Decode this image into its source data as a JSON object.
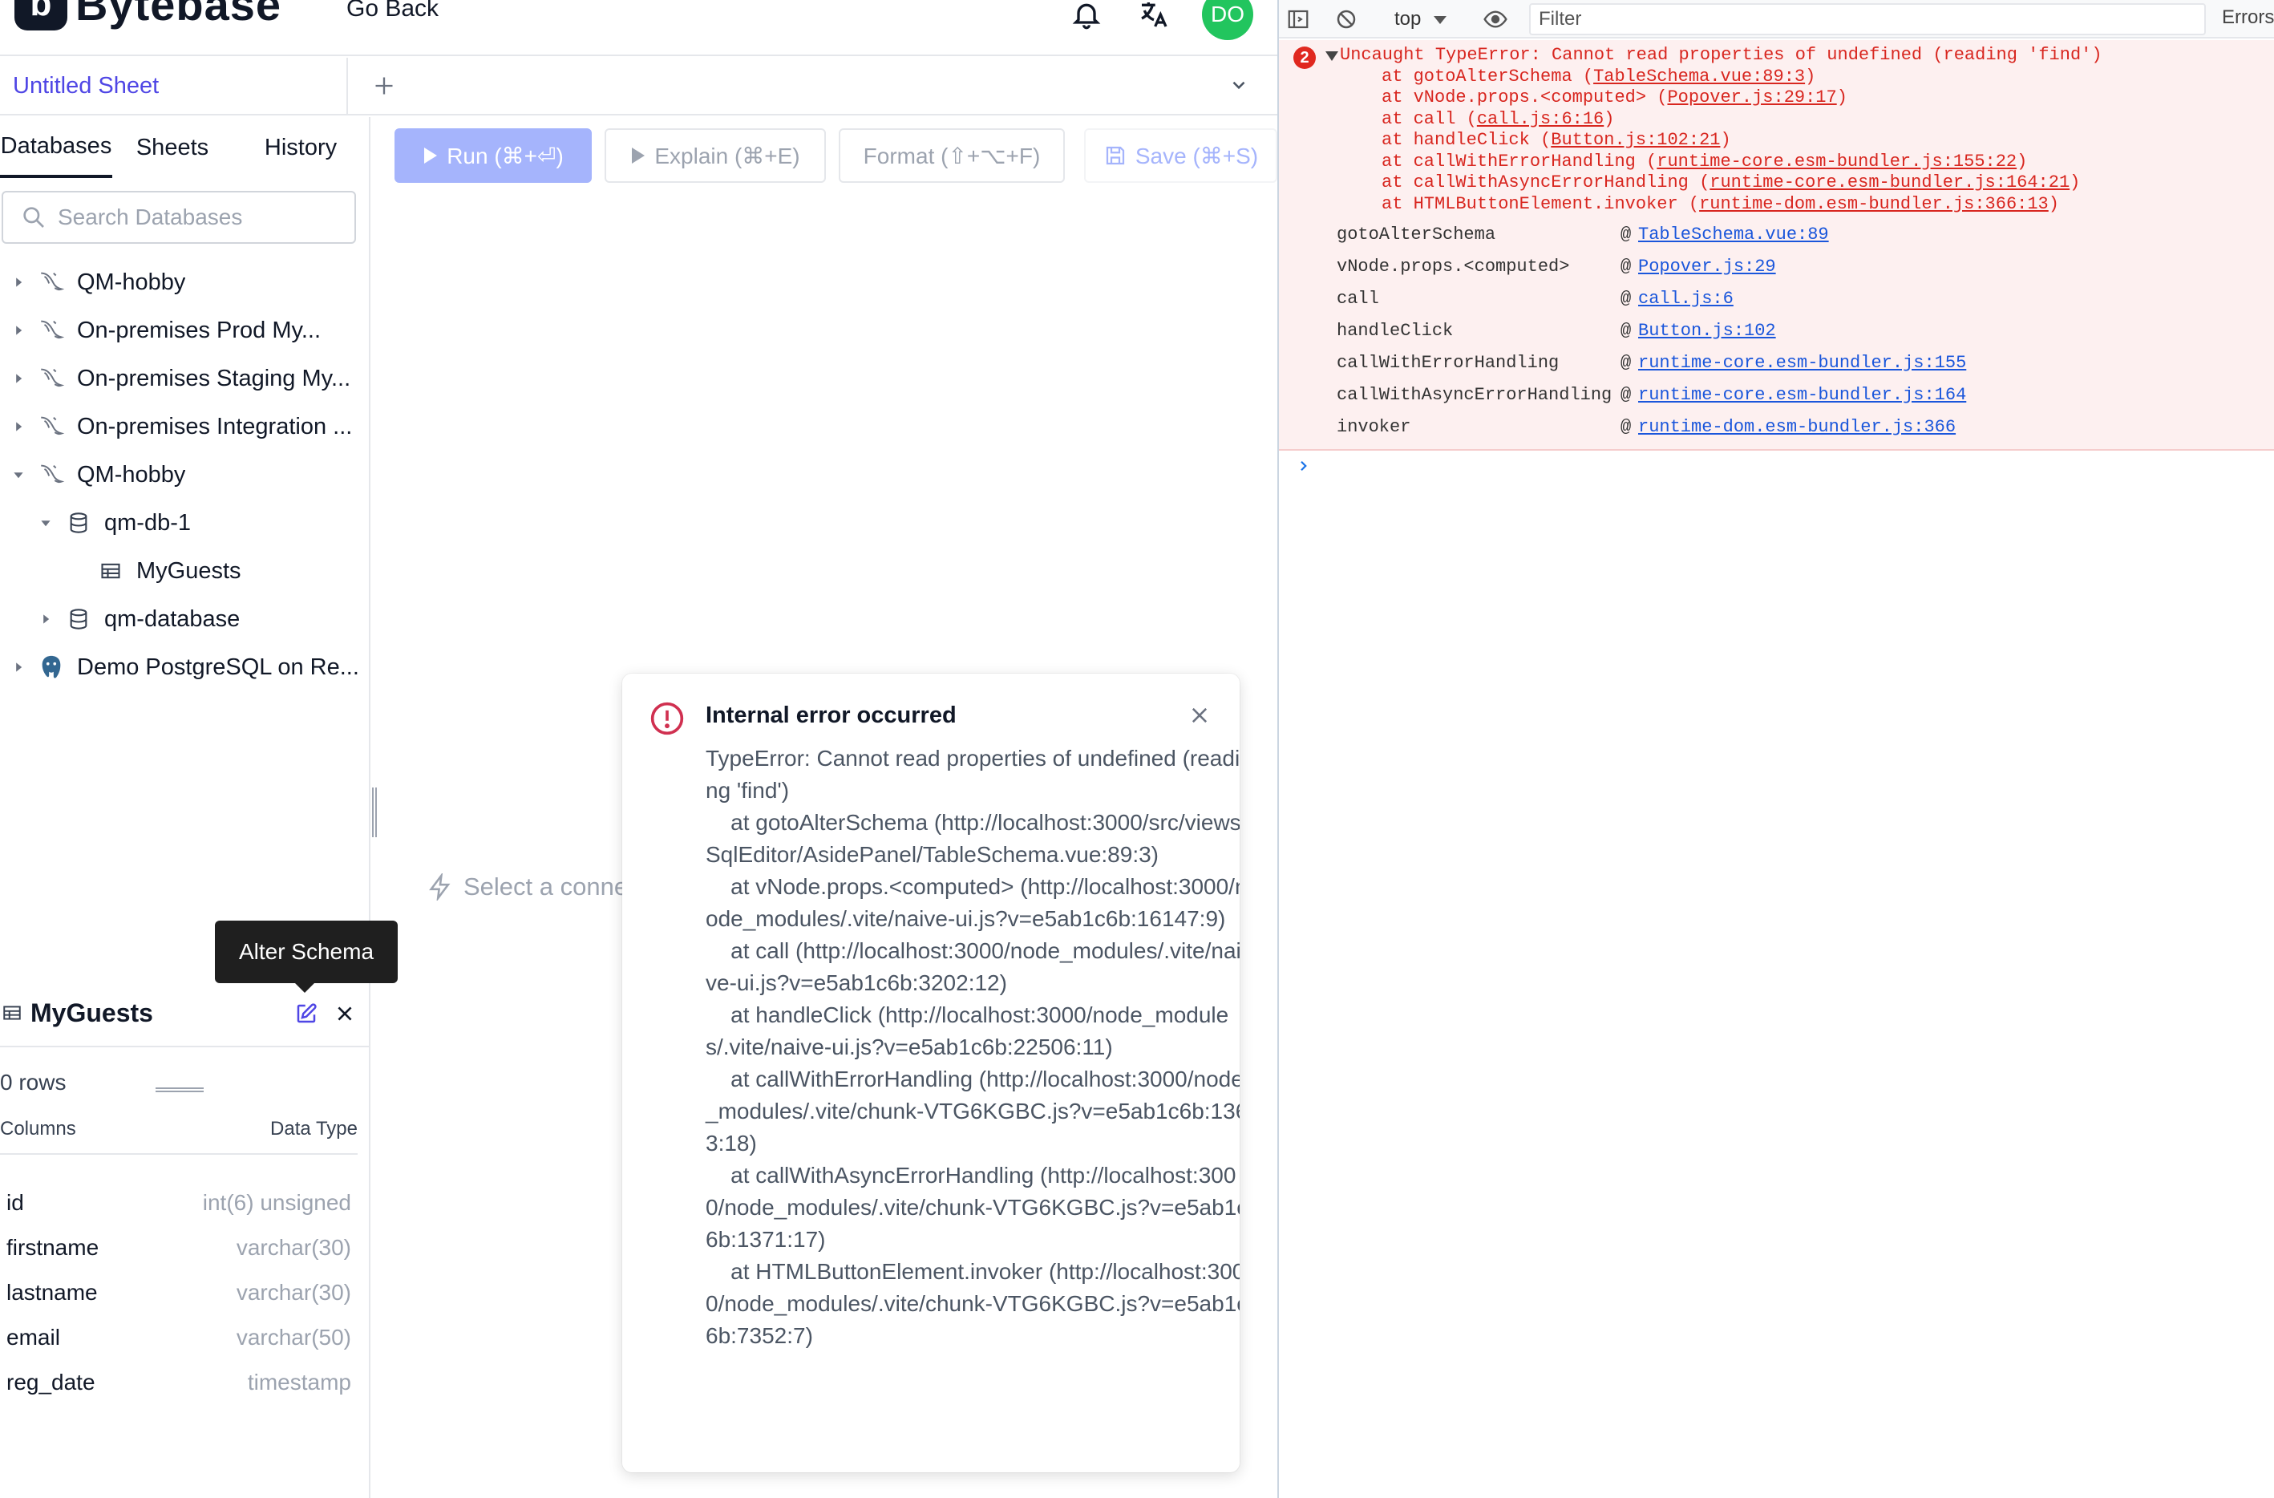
{
  "header": {
    "logo_mark": "b",
    "logo_text": "Bytebase",
    "go_back": "Go Back",
    "avatar_initials": "DO"
  },
  "sheet_tabs": {
    "active": "Untitled Sheet"
  },
  "sidebar": {
    "tabs": [
      "Databases",
      "Sheets",
      "History"
    ],
    "search_placeholder": "Search Databases",
    "tree": [
      {
        "label": "QM-hobby",
        "icon": "mysql-icon",
        "expanded": false,
        "level": 0
      },
      {
        "label": "On-premises Prod My...",
        "icon": "mysql-icon",
        "expanded": false,
        "level": 0
      },
      {
        "label": "On-premises Staging My...",
        "icon": "mysql-icon",
        "expanded": false,
        "level": 0
      },
      {
        "label": "On-premises Integration ...",
        "icon": "mysql-icon",
        "expanded": false,
        "level": 0
      },
      {
        "label": "QM-hobby",
        "icon": "mysql-icon",
        "expanded": true,
        "level": 0
      },
      {
        "label": "qm-db-1",
        "icon": "database-icon",
        "expanded": true,
        "level": 1
      },
      {
        "label": "MyGuests",
        "icon": "table-icon",
        "expanded": null,
        "level": 2
      },
      {
        "label": "qm-database",
        "icon": "database-icon",
        "expanded": false,
        "level": 1
      },
      {
        "label": "Demo PostgreSQL on Re...",
        "icon": "postgresql-icon",
        "expanded": false,
        "level": 0
      }
    ]
  },
  "table_panel": {
    "title": "MyGuests",
    "rows": "0 rows",
    "col_header": "Columns",
    "type_header": "Data Type",
    "columns": [
      {
        "name": "id",
        "type": "int(6) unsigned"
      },
      {
        "name": "firstname",
        "type": "varchar(30)"
      },
      {
        "name": "lastname",
        "type": "varchar(30)"
      },
      {
        "name": "email",
        "type": "varchar(50)"
      },
      {
        "name": "reg_date",
        "type": "timestamp"
      }
    ]
  },
  "tooltip": "Alter Schema",
  "toolbar": {
    "run": "Run (⌘+⏎)",
    "explain": "Explain (⌘+E)",
    "format": "Format (⇧+⌥+F)",
    "save": "Save (⌘+S)"
  },
  "editor": {
    "hint": "Select a connection"
  },
  "dialog": {
    "title": "Internal error occurred",
    "body": "TypeError: Cannot read properties of undefined (reading 'find')\n    at gotoAlterSchema (http://localhost:3000/src/views/SqlEditor/AsidePanel/TableSchema.vue:89:3)\n    at vNode.props.<computed> (http://localhost:3000/node_modules/.vite/naive-ui.js?v=e5ab1c6b:16147:9)\n    at call (http://localhost:3000/node_modules/.vite/naive-ui.js?v=e5ab1c6b:3202:12)\n    at handleClick (http://localhost:3000/node_modules/.vite/naive-ui.js?v=e5ab1c6b:22506:11)\n    at callWithErrorHandling (http://localhost:3000/node_modules/.vite/chunk-VTG6KGBC.js?v=e5ab1c6b:1363:18)\n    at callWithAsyncErrorHandling (http://localhost:3000/node_modules/.vite/chunk-VTG6KGBC.js?v=e5ab1c6b:1371:17)\n    at HTMLButtonElement.invoker (http://localhost:3000/node_modules/.vite/chunk-VTG6KGBC.js?v=e5ab1c6b:7352:7)"
  },
  "devtools": {
    "context": "top",
    "filter_placeholder": "Filter",
    "levels": "Errors",
    "error_count": "2",
    "error_message": "Uncaught TypeError: Cannot read properties of undefined (reading 'find')",
    "error_frames": [
      {
        "fn": "gotoAlterSchema",
        "loc": "TableSchema.vue:89:3"
      },
      {
        "fn": "vNode.props.<computed>",
        "loc": "Popover.js:29:17"
      },
      {
        "fn": "call",
        "loc": "call.js:6:16"
      },
      {
        "fn": "handleClick",
        "loc": "Button.js:102:21"
      },
      {
        "fn": "callWithErrorHandling",
        "loc": "runtime-core.esm-bundler.js:155:22"
      },
      {
        "fn": "callWithAsyncErrorHandling",
        "loc": "runtime-core.esm-bundler.js:164:21"
      },
      {
        "fn": "HTMLButtonElement.invoker",
        "loc": "runtime-dom.esm-bundler.js:366:13"
      }
    ],
    "stack": [
      {
        "fn": "gotoAlterSchema",
        "link": "TableSchema.vue:89"
      },
      {
        "fn": "vNode.props.<computed>",
        "link": "Popover.js:29"
      },
      {
        "fn": "call",
        "link": "call.js:6"
      },
      {
        "fn": "handleClick",
        "link": "Button.js:102"
      },
      {
        "fn": "callWithErrorHandling",
        "link": "runtime-core.esm-bundler.js:155"
      },
      {
        "fn": "callWithAsyncErrorHandling",
        "link": "runtime-core.esm-bundler.js:164"
      },
      {
        "fn": "invoker",
        "link": "runtime-dom.esm-bundler.js:366"
      }
    ],
    "prompt": "›"
  },
  "colors": {
    "accent": "#4f46e5",
    "run_button": "#a5b4fc",
    "error_red": "#d8261f",
    "error_bg": "#fdf0f0",
    "avatar": "#22c55e"
  }
}
